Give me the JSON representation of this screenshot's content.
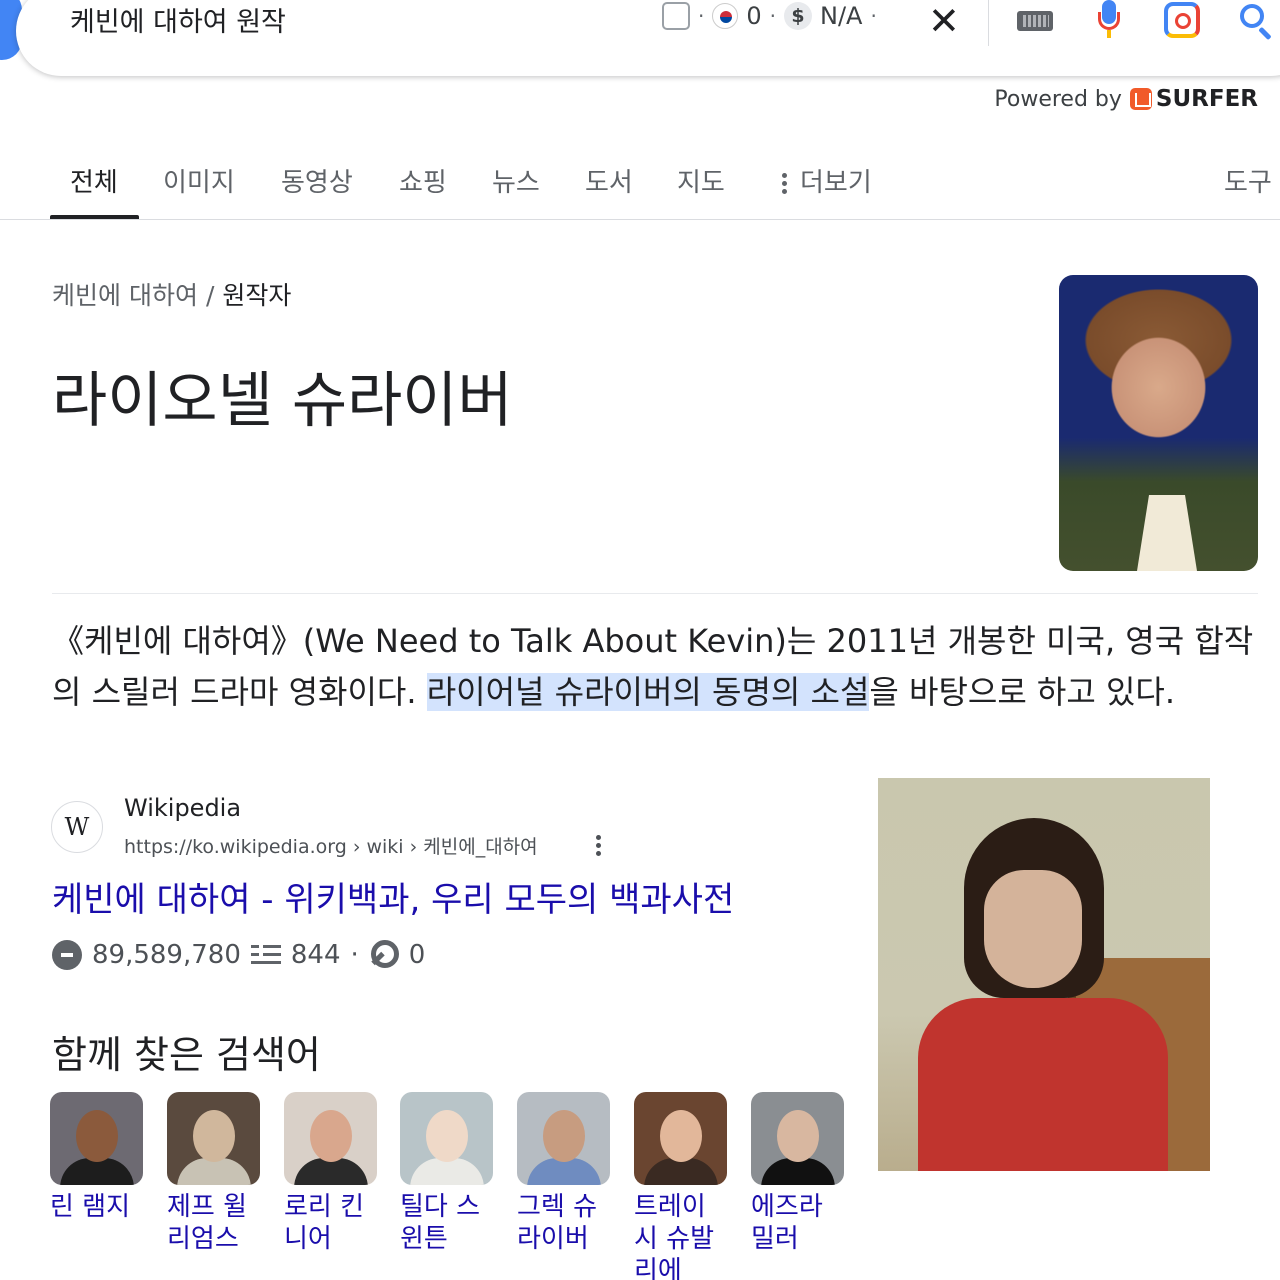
{
  "search": {
    "query": "케빈에 대하여 원작",
    "extension": {
      "flag_count": "0",
      "cpc": "N/A",
      "separator": "·",
      "close_glyph": "✕"
    }
  },
  "powered_by": {
    "label": "Powered by",
    "brand": "SURFER",
    "brand_color": "#f15a29"
  },
  "tabs": [
    {
      "label": "전체",
      "active": true
    },
    {
      "label": "이미지"
    },
    {
      "label": "동영상"
    },
    {
      "label": "쇼핑"
    },
    {
      "label": "뉴스"
    },
    {
      "label": "도서"
    },
    {
      "label": "지도"
    },
    {
      "label": "더보기"
    },
    {
      "label": "도구"
    }
  ],
  "knowledge_panel": {
    "breadcrumb": {
      "parent": "케빈에 대하여",
      "separator": "/",
      "current": "원작자"
    },
    "title": "라이오넬 슈라이버",
    "description_before": "《케빈에 대하여》(We Need to Talk About Kevin)는 2011년 개봉한 미국, 영국 합작의 스릴러 드라마 영화이다. ",
    "description_highlight": "라이어널 슈라이버의 동명의 소설",
    "description_after": "을 바탕으로 하고 있다.",
    "highlight_color": "#d3e3fd"
  },
  "source": {
    "favicon_letter": "W",
    "name": "Wikipedia",
    "url": "https://ko.wikipedia.org › wiki › 케빈에_대하여",
    "link_title": "케빈에 대하여 - 위키백과, 우리 모두의 백과사전",
    "link_color": "#1a0dab",
    "stats": {
      "visits": "89,589,780",
      "pages": "844",
      "separator": "·",
      "keywords": "0"
    }
  },
  "also_searched": {
    "title": "함께 찾은 검색어",
    "people": [
      {
        "name": "린 램지"
      },
      {
        "name": "제프 윌리엄스"
      },
      {
        "name": "로리 킨니어"
      },
      {
        "name": "틸다 스윈튼"
      },
      {
        "name": "그렉 슈라이버"
      },
      {
        "name": "트레이시 슈발리에"
      },
      {
        "name": "에즈라 밀러"
      }
    ]
  }
}
